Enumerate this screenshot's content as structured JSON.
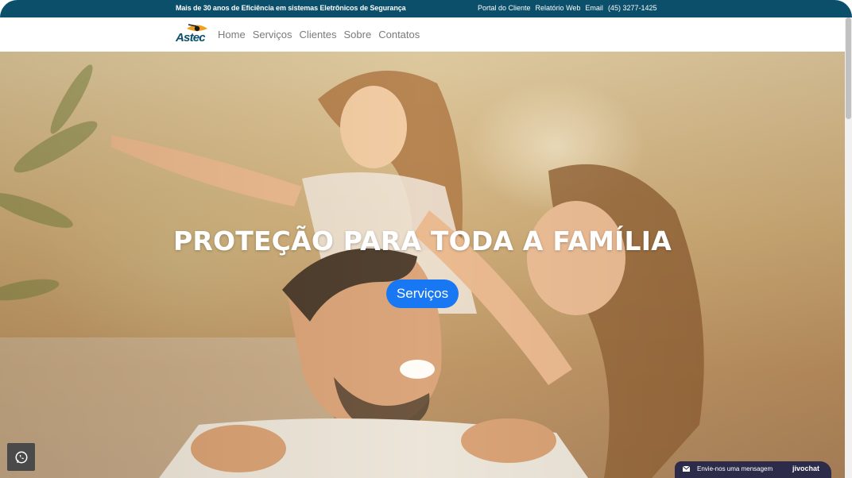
{
  "topbar": {
    "tagline": "Mais de 30 anos de Eficiência em sistemas Eletrônicos de Segurança",
    "links": [
      "Portal do Cliente",
      "Relatório Web",
      "Email"
    ],
    "phone": "(45) 3277-1425"
  },
  "navbar": {
    "logo_text": "Astec",
    "links": [
      "Home",
      "Serviços",
      "Clientes",
      "Sobre",
      "Contatos"
    ]
  },
  "hero": {
    "title": "PROTEÇÃO PARA TODA A FAMÍLIA",
    "button_label": "Serviços"
  },
  "chat_widget": {
    "message": "Envie-nos uma mensagem",
    "brand": "jivochat"
  },
  "icons": {
    "whatsapp": "whatsapp-icon",
    "mail": "mail-icon"
  },
  "colors": {
    "topbar": "#0b4f6b",
    "button": "#1877f2",
    "nav_text": "#7a7a7a"
  }
}
